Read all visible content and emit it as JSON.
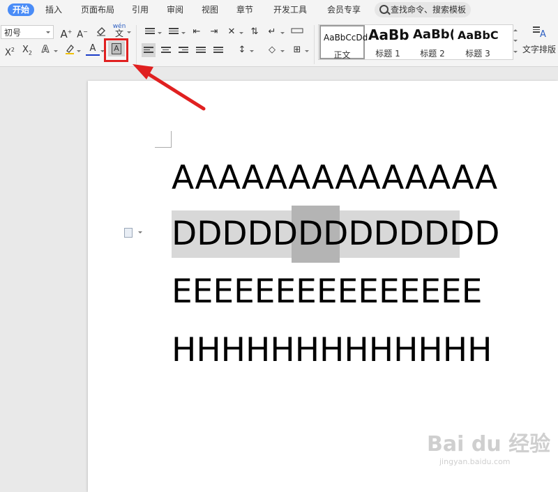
{
  "menu": {
    "tabs": [
      "开始",
      "插入",
      "页面布局",
      "引用",
      "审阅",
      "视图",
      "章节",
      "开发工具",
      "会员专享"
    ],
    "active": "开始",
    "search_placeholder": "查找命令、搜索模板"
  },
  "ribbon": {
    "font_size": "初号",
    "char_shading_glyph": "A",
    "styles": [
      {
        "preview": "AaBbCcDd",
        "label": "正文"
      },
      {
        "preview": "AaBb",
        "label": "标题 1"
      },
      {
        "preview": "AaBb(",
        "label": "标题 2"
      },
      {
        "preview": "AaBbC(",
        "label": "标题 3"
      }
    ],
    "text_layout_label": "文字排版",
    "wen_label": "wén"
  },
  "document": {
    "lines": [
      "AAAAAAAAAAAAAA",
      "DDDDDDDDDDDDD",
      "EEEEEEEEEEEEEEE",
      "HHHHHHHHHHHHH"
    ]
  },
  "watermark": {
    "brand": "Bai du 经验",
    "url": "jingyan.baidu.com"
  },
  "colors": {
    "accent": "#4a8cf7",
    "annotation": "#e02020"
  }
}
